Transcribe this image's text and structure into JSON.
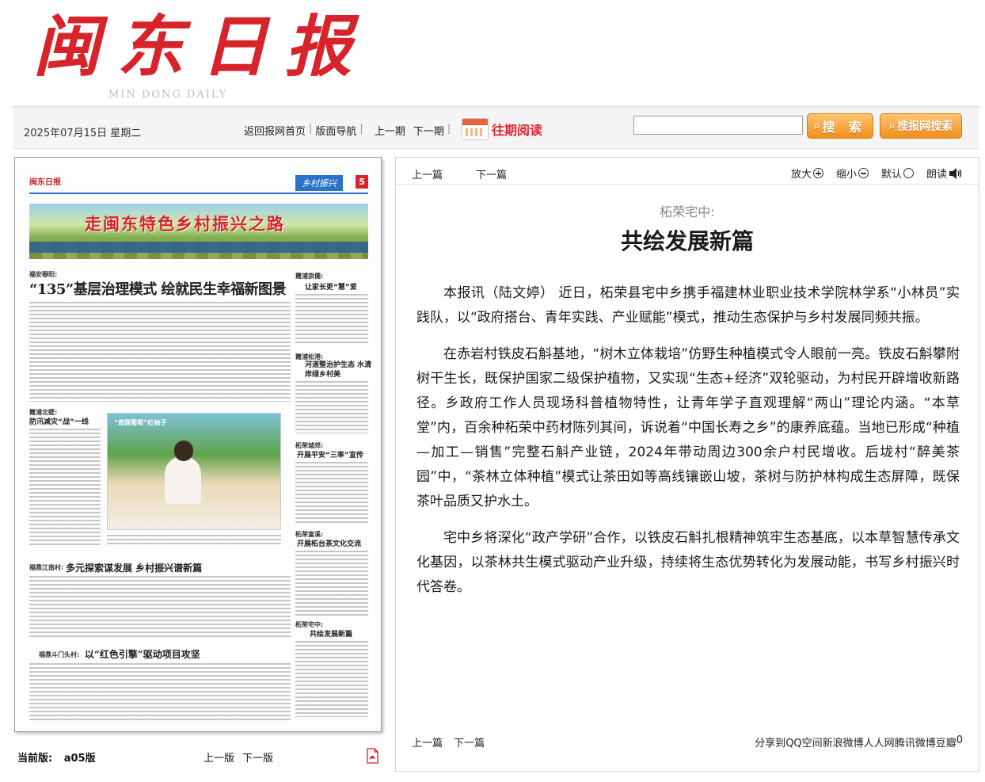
{
  "masthead": {
    "logo_cn": "闽东日报",
    "logo_en": "MIN DONG DAILY"
  },
  "navbar": {
    "date": "2025年07月15日 星期二",
    "home": "返回报网首页",
    "layout_nav": "版面导航",
    "prev_issue": "上一期",
    "next_issue": "下一期",
    "past_reading": "往期阅读",
    "search_value": "",
    "search_button": "搜 索",
    "net_search_button": "搜报网搜索"
  },
  "thumbnail": {
    "mini_logo": "闽东日报",
    "edition_tag": "乡村振兴",
    "page_no": "5",
    "banner_title": "走闽东特色乡村振兴之路",
    "kicker1": "福安穆阳:",
    "headline1": "“135”基层治理模式 绘就民生幸福新图景",
    "kicker2": "霞浦崇儒:",
    "side1": "让家长更“慧”爱",
    "kicker3": "霞浦松港:",
    "side2": "河道整治护生态 水清岸绿乡村美",
    "kicker4": "霞浦北壁:",
    "left1": "防汛减灾“战”一线",
    "photo_caption": "“南国葡萄”红柚子",
    "kicker5": "柘荣城郊:",
    "side3": "开展平安“三率”宣传",
    "kicker6": "柘荣富溪:",
    "side4": "开展柘台茶文化交流",
    "kicker7": "福鼎江南村:",
    "headline2": "多元探索谋发展 乡村振兴谱新篇",
    "kicker8": "柘荣宅中:",
    "side5": "共绘发展新篇",
    "kicker9": "福鼎斗门头村:",
    "headline3": "以“红色引擎”驱动项目攻坚"
  },
  "edition_bar": {
    "current_label": "当前版:",
    "current_value": "a05版",
    "prev_page": "上一版",
    "next_page": "下一版",
    "pdf_icon": "pdf-icon"
  },
  "article": {
    "prev": "上一篇",
    "next": "下一篇",
    "zoom_in": "放大",
    "zoom_out": "缩小",
    "default": "默认",
    "read_aloud": "朗读",
    "kicker": "柘荣宅中:",
    "title": "共绘发展新篇",
    "paragraphs": [
      "本报讯（陆文婷） 近日，柘荣县宅中乡携手福建林业职业技术学院林学系“小林员”实践队，以“政府搭台、青年实践、产业赋能”模式，推动生态保护与乡村发展同频共振。",
      "在赤岩村铁皮石斛基地，“树木立体栽培”仿野生种植模式令人眼前一亮。铁皮石斛攀附树干生长，既保护国家二级保护植物，又实现“生态+经济”双轮驱动，为村民开辟增收新路径。乡政府工作人员现场科普植物特性，让青年学子直观理解“两山”理论内涵。“本草堂”内，百余种柘荣中药材陈列其间，诉说着“中国长寿之乡”的康养底蕴。当地已形成“种植—加工—销售”完整石斛产业链，2024年带动周边300余户村民增收。后垅村“醉美茶园”中，“茶林立体种植”模式让茶田如等高线镶嵌山坡，茶树与防护林构成生态屏障，既保茶叶品质又护水土。",
      "宅中乡将深化“政产学研”合作，以铁皮石斛扎根精神筑牢生态基底，以本草智慧传承文化基因，以茶林共生模式驱动产业升级，持续将生态优势转化为发展动能，书写乡村振兴时代答卷。"
    ],
    "bottom_prev": "上一篇",
    "bottom_next": "下一篇",
    "share": {
      "label": "分享到",
      "qzone": "QQ空间",
      "weibo": "新浪微博",
      "renren": "人人网",
      "tweibo": "腾讯微博",
      "douban": "豆瓣",
      "count": "0"
    }
  },
  "colors": {
    "brand_red": "#d8232a",
    "search_orange": "#f08f1d",
    "edition_blue": "#2a73c9"
  }
}
